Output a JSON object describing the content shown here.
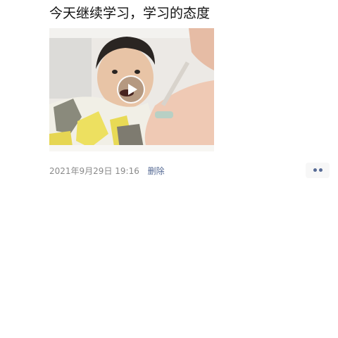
{
  "post": {
    "text": "今天继续学习，学习的态度",
    "video": {
      "icon": "play-icon"
    },
    "timestamp": "2021年9月29日 19:16",
    "delete_label": "删除",
    "more_icon": "more-dots-icon"
  },
  "colors": {
    "link": "#576b95",
    "meta": "#8a8a8a",
    "text": "#111111",
    "background": "#ffffff"
  }
}
